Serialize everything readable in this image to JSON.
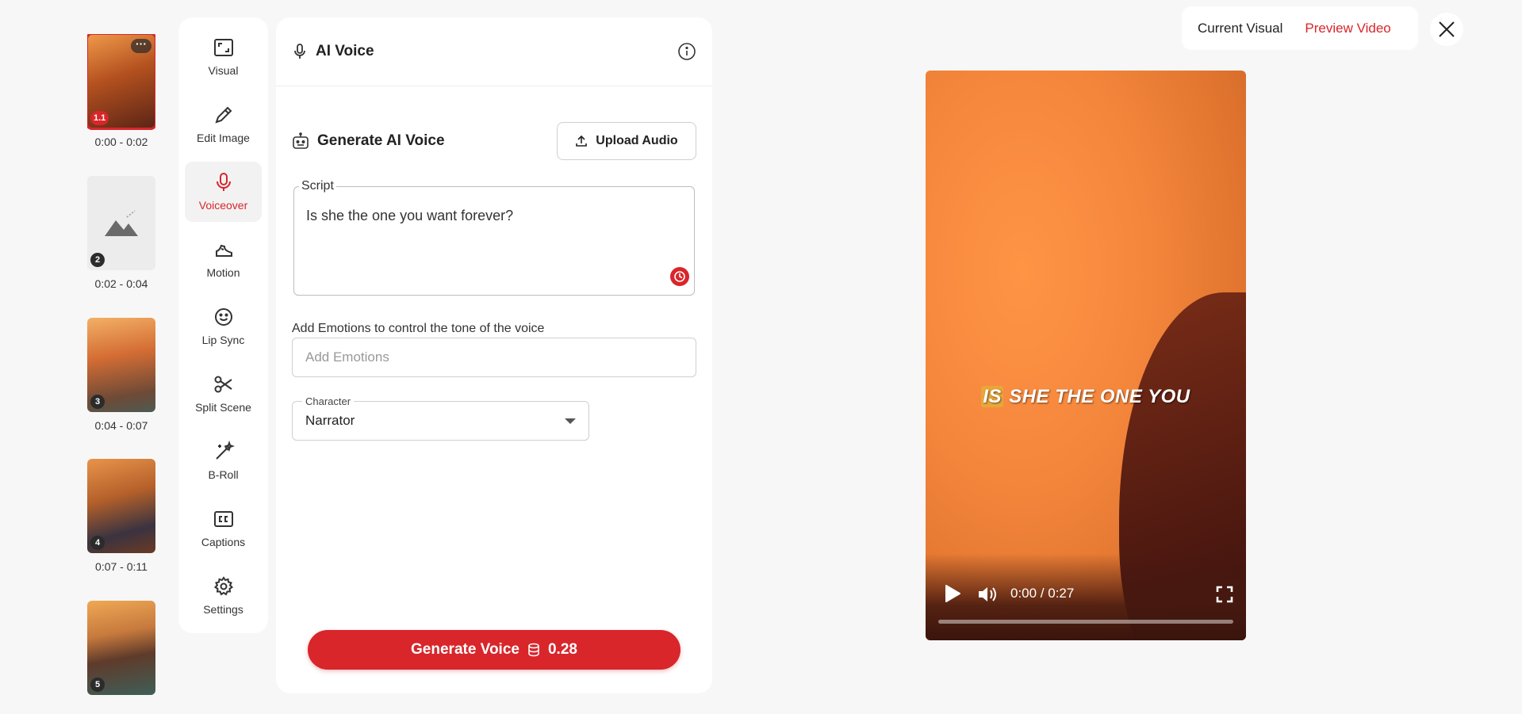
{
  "scenes": [
    {
      "number": "1.1",
      "time": "0:00 - 0:02",
      "selected": true
    },
    {
      "number": "2",
      "time": "0:02 - 0:04",
      "selected": false
    },
    {
      "number": "3",
      "time": "0:04 - 0:07",
      "selected": false
    },
    {
      "number": "4",
      "time": "0:07 - 0:11",
      "selected": false
    },
    {
      "number": "5",
      "time": "",
      "selected": false
    }
  ],
  "tools": [
    {
      "label": "Visual",
      "icon": "expand-icon"
    },
    {
      "label": "Edit Image",
      "icon": "pencil-icon"
    },
    {
      "label": "Voiceover",
      "icon": "microphone-icon",
      "active": true
    },
    {
      "label": "Motion",
      "icon": "running-shoe-icon"
    },
    {
      "label": "Lip Sync",
      "icon": "smiley-icon"
    },
    {
      "label": "Split Scene",
      "icon": "scissors-icon"
    },
    {
      "label": "B-Roll",
      "icon": "magic-wand-icon"
    },
    {
      "label": "Captions",
      "icon": "cc-icon"
    },
    {
      "label": "Settings",
      "icon": "gear-icon"
    }
  ],
  "panel": {
    "title": "AI Voice",
    "generate_title": "Generate AI Voice",
    "upload_label": "Upload Audio",
    "script_legend": "Script",
    "script_text": "Is she the one you want forever?",
    "emotions_label": "Add Emotions to control the tone of the voice",
    "emotions_placeholder": "Add Emotions",
    "character_legend": "Character",
    "character_value": "Narrator",
    "generate_button": "Generate Voice",
    "generate_cost": "0.28"
  },
  "view": {
    "current_visual": "Current Visual",
    "preview_video": "Preview Video"
  },
  "video": {
    "caption_highlight": "IS",
    "caption_rest": "SHE THE ONE YOU",
    "time": "0:00 / 0:27",
    "progress": 0
  },
  "colors": {
    "accent": "#d8262b",
    "background": "#f7f7f7"
  }
}
